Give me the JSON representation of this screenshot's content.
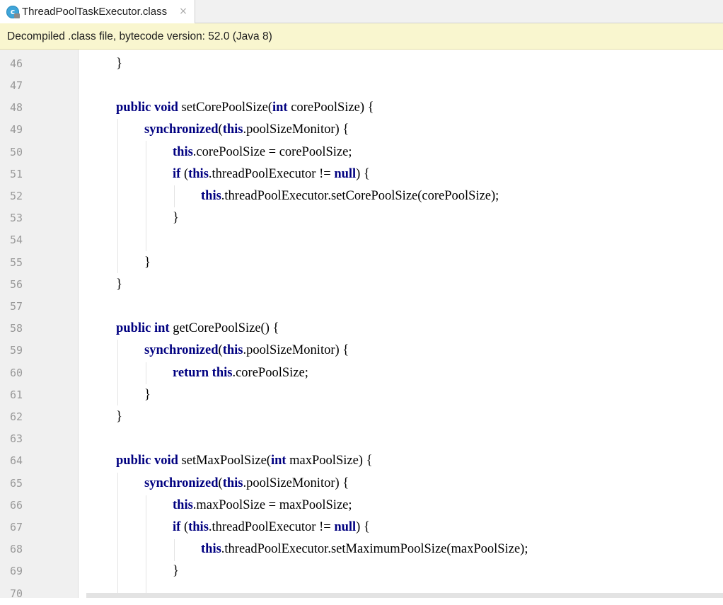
{
  "tab": {
    "icon_letter": "c",
    "title": "ThreadPoolTaskExecutor.class",
    "close_glyph": "×"
  },
  "banner": {
    "text": "Decompiled .class file, bytecode version: 52.0 (Java 8)"
  },
  "code": {
    "line_numbers": [
      "46",
      "47",
      "48",
      "49",
      "50",
      "51",
      "52",
      "53",
      "54",
      "55",
      "56",
      "57",
      "58",
      "59",
      "60",
      "61",
      "62",
      "63",
      "64",
      "65",
      "66",
      "67",
      "68",
      "69",
      "70"
    ],
    "lines": [
      {
        "indent": 0,
        "tokens": [
          {
            "t": "}",
            "k": "p"
          }
        ]
      },
      {
        "indent": 0,
        "tokens": []
      },
      {
        "indent": 0,
        "tokens": [
          {
            "t": "public",
            "k": "kw"
          },
          {
            "t": " ",
            "k": "p"
          },
          {
            "t": "void",
            "k": "kw"
          },
          {
            "t": " setCorePoolSize(",
            "k": "p"
          },
          {
            "t": "int",
            "k": "kw"
          },
          {
            "t": " corePoolSize) {",
            "k": "p"
          }
        ]
      },
      {
        "indent": 1,
        "tokens": [
          {
            "t": "synchronized",
            "k": "kw"
          },
          {
            "t": "(",
            "k": "p"
          },
          {
            "t": "this",
            "k": "kw"
          },
          {
            "t": ".poolSizeMonitor) {",
            "k": "p"
          }
        ]
      },
      {
        "indent": 2,
        "tokens": [
          {
            "t": "this",
            "k": "kw"
          },
          {
            "t": ".corePoolSize = corePoolSize;",
            "k": "p"
          }
        ]
      },
      {
        "indent": 2,
        "tokens": [
          {
            "t": "if",
            "k": "kw"
          },
          {
            "t": " (",
            "k": "p"
          },
          {
            "t": "this",
            "k": "kw"
          },
          {
            "t": ".threadPoolExecutor != ",
            "k": "p"
          },
          {
            "t": "null",
            "k": "kw"
          },
          {
            "t": ") {",
            "k": "p"
          }
        ]
      },
      {
        "indent": 3,
        "tokens": [
          {
            "t": "this",
            "k": "kw"
          },
          {
            "t": ".threadPoolExecutor.setCorePoolSize(corePoolSize);",
            "k": "p"
          }
        ]
      },
      {
        "indent": 2,
        "tokens": [
          {
            "t": "}",
            "k": "p"
          }
        ]
      },
      {
        "indent": 0,
        "tokens": []
      },
      {
        "indent": 1,
        "tokens": [
          {
            "t": "}",
            "k": "p"
          }
        ]
      },
      {
        "indent": 0,
        "tokens": [
          {
            "t": "}",
            "k": "p"
          }
        ]
      },
      {
        "indent": 0,
        "tokens": []
      },
      {
        "indent": 0,
        "tokens": [
          {
            "t": "public",
            "k": "kw"
          },
          {
            "t": " ",
            "k": "p"
          },
          {
            "t": "int",
            "k": "kw"
          },
          {
            "t": " getCorePoolSize() {",
            "k": "p"
          }
        ]
      },
      {
        "indent": 1,
        "tokens": [
          {
            "t": "synchronized",
            "k": "kw"
          },
          {
            "t": "(",
            "k": "p"
          },
          {
            "t": "this",
            "k": "kw"
          },
          {
            "t": ".poolSizeMonitor) {",
            "k": "p"
          }
        ]
      },
      {
        "indent": 2,
        "tokens": [
          {
            "t": "return",
            "k": "kw"
          },
          {
            "t": " ",
            "k": "p"
          },
          {
            "t": "this",
            "k": "kw"
          },
          {
            "t": ".corePoolSize;",
            "k": "p"
          }
        ]
      },
      {
        "indent": 1,
        "tokens": [
          {
            "t": "}",
            "k": "p"
          }
        ]
      },
      {
        "indent": 0,
        "tokens": [
          {
            "t": "}",
            "k": "p"
          }
        ]
      },
      {
        "indent": 0,
        "tokens": []
      },
      {
        "indent": 0,
        "tokens": [
          {
            "t": "public",
            "k": "kw"
          },
          {
            "t": " ",
            "k": "p"
          },
          {
            "t": "void",
            "k": "kw"
          },
          {
            "t": " setMaxPoolSize(",
            "k": "p"
          },
          {
            "t": "int",
            "k": "kw"
          },
          {
            "t": " maxPoolSize) {",
            "k": "p"
          }
        ]
      },
      {
        "indent": 1,
        "tokens": [
          {
            "t": "synchronized",
            "k": "kw"
          },
          {
            "t": "(",
            "k": "p"
          },
          {
            "t": "this",
            "k": "kw"
          },
          {
            "t": ".poolSizeMonitor) {",
            "k": "p"
          }
        ]
      },
      {
        "indent": 2,
        "tokens": [
          {
            "t": "this",
            "k": "kw"
          },
          {
            "t": ".maxPoolSize = maxPoolSize;",
            "k": "p"
          }
        ]
      },
      {
        "indent": 2,
        "tokens": [
          {
            "t": "if",
            "k": "kw"
          },
          {
            "t": " (",
            "k": "p"
          },
          {
            "t": "this",
            "k": "kw"
          },
          {
            "t": ".threadPoolExecutor != ",
            "k": "p"
          },
          {
            "t": "null",
            "k": "kw"
          },
          {
            "t": ") {",
            "k": "p"
          }
        ]
      },
      {
        "indent": 3,
        "tokens": [
          {
            "t": "this",
            "k": "kw"
          },
          {
            "t": ".threadPoolExecutor.setMaximumPoolSize(maxPoolSize);",
            "k": "p"
          }
        ]
      },
      {
        "indent": 2,
        "tokens": [
          {
            "t": "}",
            "k": "p"
          }
        ]
      },
      {
        "indent": 0,
        "tokens": []
      }
    ]
  },
  "colors": {
    "keyword": "#000080",
    "line_number": "#999999",
    "banner_bg": "#f9f6cf",
    "gutter_bg": "#f0f0f0"
  }
}
